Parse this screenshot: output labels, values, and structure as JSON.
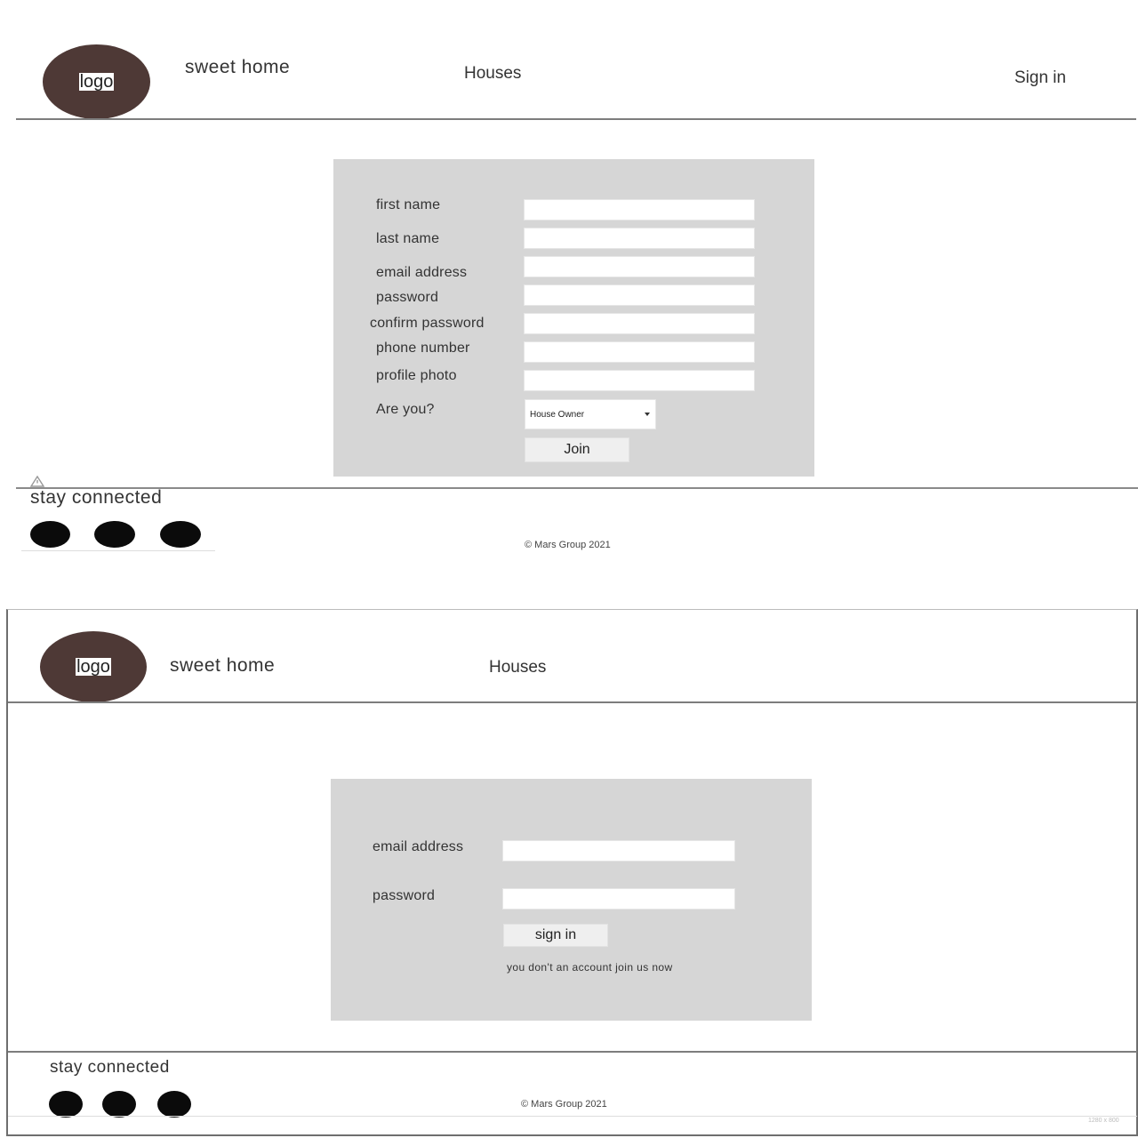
{
  "signup": {
    "header": {
      "logo_label": "logo",
      "brand": "sweet home",
      "nav_houses": "Houses",
      "nav_signin": "Sign in"
    },
    "form": {
      "fields": [
        {
          "label": "first name",
          "value": ""
        },
        {
          "label": "last name",
          "value": ""
        },
        {
          "label": "email address",
          "value": ""
        },
        {
          "label": "password",
          "value": ""
        },
        {
          "label": "confirm password",
          "value": ""
        },
        {
          "label": "phone number",
          "value": ""
        },
        {
          "label": "profile photo",
          "value": ""
        }
      ],
      "role_label": "Are you?",
      "role_selected": "House Owner",
      "submit_label": "Join"
    },
    "footer": {
      "title": "stay connected",
      "social_icons": [
        "social-icon-1",
        "social-icon-2",
        "social-icon-3"
      ],
      "copyright": "© Mars Group 2021"
    }
  },
  "signin": {
    "header": {
      "logo_label": "logo",
      "brand": "sweet home",
      "nav_houses": "Houses"
    },
    "form": {
      "email_label": "email address",
      "email_value": "",
      "password_label": "password",
      "password_value": "",
      "submit_label": "sign in",
      "join_text": "you don't an account join us now"
    },
    "footer": {
      "title": "stay connected",
      "social_icons": [
        "social-icon-1",
        "social-icon-2",
        "social-icon-3"
      ],
      "copyright": "© Mars Group 2021"
    },
    "corner_note": "1280 x 800"
  },
  "colors": {
    "logo_bg": "#4e3936",
    "panel_bg": "#d6d6d6",
    "divider": "#7d7d7d",
    "social_dot": "#0b0b0b"
  }
}
